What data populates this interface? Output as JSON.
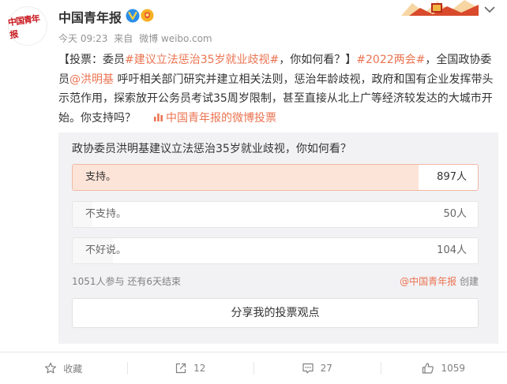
{
  "header": {
    "account_name": "中国青年报",
    "avatar_text": "中国青年报",
    "time": "今天 09:23",
    "source_prefix": "来自",
    "source": "微博 weibo.com"
  },
  "post": {
    "open_bracket": "【投票：委员",
    "topic1": "#建议立法惩治35岁就业歧视#",
    "mid1": "，你如何看？】",
    "topic2": "#2022两会#",
    "mid2": "，全国政协委员",
    "mention": "@洪明基",
    "body": " 呼吁相关部门研究并建立相关法则，惩治年龄歧视，政府和国有企业发挥带头示范作用，探索放开公务员考试35周岁限制，甚至直接从北上广等经济较发达的大城市开始。你支持吗？",
    "vote_link": "中国青年报的微博投票"
  },
  "poll": {
    "question": "政协委员洪明基建议立法惩治35岁就业歧视，你如何看？",
    "options": [
      {
        "label": "支持。",
        "count": "897人",
        "fraction": 0.853
      },
      {
        "label": "不支持。",
        "count": "50人",
        "fraction": 0.048
      },
      {
        "label": "不好说。",
        "count": "104人",
        "fraction": 0.099
      }
    ],
    "participants": "1051人参与",
    "remaining": "还有6天结束",
    "creator": "@中国青年报",
    "created_label": "创建",
    "share_label": "分享我的投票观点"
  },
  "actions": {
    "favorite": "收藏",
    "repost": "12",
    "comment": "27",
    "like": "1059"
  },
  "colors": {
    "accent": "#eb7350",
    "selected_fill": "#fde4d8"
  }
}
